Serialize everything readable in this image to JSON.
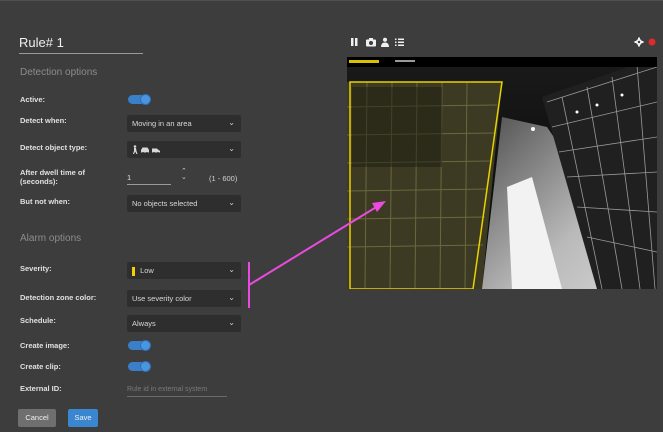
{
  "rule": {
    "title": "Rule# 1"
  },
  "detection": {
    "section_title": "Detection options",
    "active_label": "Active:",
    "active": true,
    "detect_when_label": "Detect when:",
    "detect_when_value": "Moving in an area",
    "object_type_label": "Detect object type:",
    "object_type_icons": [
      "person-icon",
      "car-icon",
      "vehicle-icon"
    ],
    "dwell_label_line1": "After dwell time of",
    "dwell_label_line2": "(seconds):",
    "dwell_value": "1",
    "dwell_range": "(1 - 600)",
    "not_when_label": "But not when:",
    "not_when_value": "No objects selected"
  },
  "alarm": {
    "section_title": "Alarm options",
    "severity_label": "Severity:",
    "severity_value": "Low",
    "severity_color": "#f5d000",
    "zone_color_label": "Detection zone color:",
    "zone_color_value": "Use severity color",
    "schedule_label": "Schedule:",
    "schedule_value": "Always",
    "create_image_label": "Create image:",
    "create_image": true,
    "create_clip_label": "Create clip:",
    "create_clip": true,
    "external_id_label": "External ID:",
    "external_id_placeholder": "Rule id in external system"
  },
  "actions": {
    "cancel_label": "Cancel",
    "save_label": "Save"
  },
  "video": {
    "toolbar_icons": [
      "pause-icon",
      "camera-icon",
      "person-icon",
      "list-icon"
    ],
    "right_icons": [
      "gear-icon",
      "record-dot-icon"
    ],
    "zone_color": "#e8d200"
  },
  "colors": {
    "accent": "#3a86d1",
    "annotation": "#e94be0",
    "record": "#e02a2a"
  }
}
